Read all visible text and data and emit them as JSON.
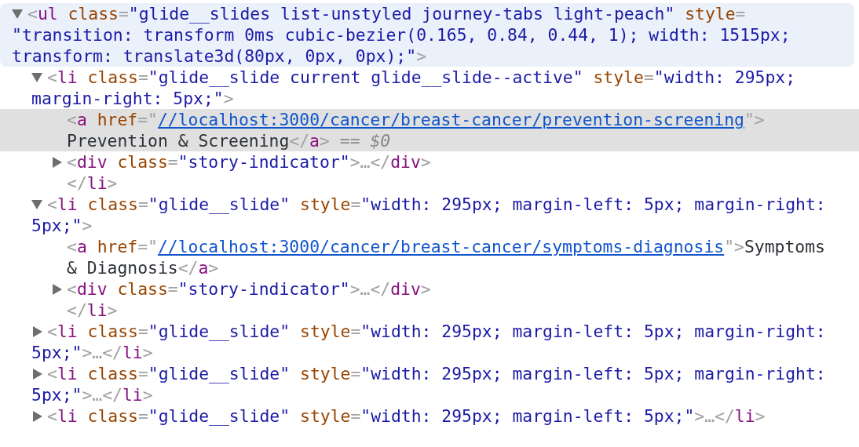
{
  "elements": [
    {
      "hovered": true,
      "expanded": true,
      "lines": [
        [
          {
            "kind": "punct",
            "text": "<"
          },
          {
            "kind": "tag",
            "text": "ul"
          },
          {
            "kind": "attr",
            "text": " class"
          },
          {
            "kind": "punct",
            "text": "="
          },
          {
            "kind": "value",
            "text": "\"glide__slides list-unstyled journey-tabs light-peach\""
          },
          {
            "kind": "attr",
            "text": " style"
          },
          {
            "kind": "punct",
            "text": "="
          }
        ],
        [
          {
            "kind": "value",
            "text": "\"transition: transform 0ms cubic-bezier(0.165, 0.84, 0.44, 1); width: 1515px;"
          }
        ],
        [
          {
            "kind": "value",
            "text": "transform: translate3d(80px, 0px, 0px);\""
          },
          {
            "kind": "punct",
            "text": ">"
          }
        ]
      ],
      "children": [
        {
          "expanded": true,
          "lines": [
            [
              {
                "kind": "punct",
                "text": "<"
              },
              {
                "kind": "tag",
                "text": "li"
              },
              {
                "kind": "attr",
                "text": " class"
              },
              {
                "kind": "punct",
                "text": "="
              },
              {
                "kind": "value",
                "text": "\"glide__slide current glide__slide--active\""
              },
              {
                "kind": "attr",
                "text": " style"
              },
              {
                "kind": "punct",
                "text": "="
              },
              {
                "kind": "value",
                "text": "\"width: 295px;"
              }
            ],
            [
              {
                "kind": "value",
                "text": "margin-right: 5px;\""
              },
              {
                "kind": "punct",
                "text": ">"
              }
            ]
          ],
          "children": [
            {
              "selected": true,
              "lines": [
                [
                  {
                    "kind": "punct",
                    "text": "<"
                  },
                  {
                    "kind": "tag",
                    "text": "a"
                  },
                  {
                    "kind": "attr",
                    "text": " href"
                  },
                  {
                    "kind": "punct",
                    "text": "=\""
                  },
                  {
                    "kind": "link",
                    "text": "//localhost:3000/cancer/breast-cancer/prevention-screening"
                  },
                  {
                    "kind": "punct",
                    "text": "\">"
                  }
                ],
                [
                  {
                    "kind": "text",
                    "text": "Prevention & Screening"
                  },
                  {
                    "kind": "punct",
                    "text": "</"
                  },
                  {
                    "kind": "tag",
                    "text": "a"
                  },
                  {
                    "kind": "punct",
                    "text": ">"
                  },
                  {
                    "kind": "dim",
                    "text": " == "
                  },
                  {
                    "kind": "var",
                    "text": "$0"
                  }
                ]
              ]
            },
            {
              "expanded": false,
              "lines": [
                [
                  {
                    "kind": "punct",
                    "text": "<"
                  },
                  {
                    "kind": "tag",
                    "text": "div"
                  },
                  {
                    "kind": "attr",
                    "text": " class"
                  },
                  {
                    "kind": "punct",
                    "text": "="
                  },
                  {
                    "kind": "value",
                    "text": "\"story-indicator\""
                  },
                  {
                    "kind": "punct",
                    "text": ">…</"
                  },
                  {
                    "kind": "tag",
                    "text": "div"
                  },
                  {
                    "kind": "punct",
                    "text": ">"
                  }
                ]
              ]
            },
            {
              "lines": [
                [
                  {
                    "kind": "punct",
                    "text": "</"
                  },
                  {
                    "kind": "tag",
                    "text": "li"
                  },
                  {
                    "kind": "punct",
                    "text": ">"
                  }
                ]
              ]
            }
          ]
        },
        {
          "expanded": true,
          "lines": [
            [
              {
                "kind": "punct",
                "text": "<"
              },
              {
                "kind": "tag",
                "text": "li"
              },
              {
                "kind": "attr",
                "text": " class"
              },
              {
                "kind": "punct",
                "text": "="
              },
              {
                "kind": "value",
                "text": "\"glide__slide\""
              },
              {
                "kind": "attr",
                "text": " style"
              },
              {
                "kind": "punct",
                "text": "="
              },
              {
                "kind": "value",
                "text": "\"width: 295px; margin-left: 5px; margin-right:"
              }
            ],
            [
              {
                "kind": "value",
                "text": "5px;\""
              },
              {
                "kind": "punct",
                "text": ">"
              }
            ]
          ],
          "children": [
            {
              "selected": false,
              "lines": [
                [
                  {
                    "kind": "punct",
                    "text": "<"
                  },
                  {
                    "kind": "tag",
                    "text": "a"
                  },
                  {
                    "kind": "attr",
                    "text": " href"
                  },
                  {
                    "kind": "punct",
                    "text": "=\""
                  },
                  {
                    "kind": "link",
                    "text": "//localhost:3000/cancer/breast-cancer/symptoms-diagnosis"
                  },
                  {
                    "kind": "punct",
                    "text": "\">"
                  },
                  {
                    "kind": "text",
                    "text": "Symptoms"
                  }
                ],
                [
                  {
                    "kind": "text",
                    "text": "& Diagnosis"
                  },
                  {
                    "kind": "punct",
                    "text": "</"
                  },
                  {
                    "kind": "tag",
                    "text": "a"
                  },
                  {
                    "kind": "punct",
                    "text": ">"
                  }
                ]
              ]
            },
            {
              "expanded": false,
              "lines": [
                [
                  {
                    "kind": "punct",
                    "text": "<"
                  },
                  {
                    "kind": "tag",
                    "text": "div"
                  },
                  {
                    "kind": "attr",
                    "text": " class"
                  },
                  {
                    "kind": "punct",
                    "text": "="
                  },
                  {
                    "kind": "value",
                    "text": "\"story-indicator\""
                  },
                  {
                    "kind": "punct",
                    "text": ">…</"
                  },
                  {
                    "kind": "tag",
                    "text": "div"
                  },
                  {
                    "kind": "punct",
                    "text": ">"
                  }
                ]
              ]
            },
            {
              "lines": [
                [
                  {
                    "kind": "punct",
                    "text": "</"
                  },
                  {
                    "kind": "tag",
                    "text": "li"
                  },
                  {
                    "kind": "punct",
                    "text": ">"
                  }
                ]
              ]
            }
          ]
        },
        {
          "expanded": false,
          "lines": [
            [
              {
                "kind": "punct",
                "text": "<"
              },
              {
                "kind": "tag",
                "text": "li"
              },
              {
                "kind": "attr",
                "text": " class"
              },
              {
                "kind": "punct",
                "text": "="
              },
              {
                "kind": "value",
                "text": "\"glide__slide\""
              },
              {
                "kind": "attr",
                "text": " style"
              },
              {
                "kind": "punct",
                "text": "="
              },
              {
                "kind": "value",
                "text": "\"width: 295px; margin-left: 5px; margin-right:"
              }
            ],
            [
              {
                "kind": "value",
                "text": "5px;\""
              },
              {
                "kind": "punct",
                "text": ">…</"
              },
              {
                "kind": "tag",
                "text": "li"
              },
              {
                "kind": "punct",
                "text": ">"
              }
            ]
          ]
        },
        {
          "expanded": false,
          "lines": [
            [
              {
                "kind": "punct",
                "text": "<"
              },
              {
                "kind": "tag",
                "text": "li"
              },
              {
                "kind": "attr",
                "text": " class"
              },
              {
                "kind": "punct",
                "text": "="
              },
              {
                "kind": "value",
                "text": "\"glide__slide\""
              },
              {
                "kind": "attr",
                "text": " style"
              },
              {
                "kind": "punct",
                "text": "="
              },
              {
                "kind": "value",
                "text": "\"width: 295px; margin-left: 5px; margin-right:"
              }
            ],
            [
              {
                "kind": "value",
                "text": "5px;\""
              },
              {
                "kind": "punct",
                "text": ">…</"
              },
              {
                "kind": "tag",
                "text": "li"
              },
              {
                "kind": "punct",
                "text": ">"
              }
            ]
          ]
        },
        {
          "expanded": false,
          "lines": [
            [
              {
                "kind": "punct",
                "text": "<"
              },
              {
                "kind": "tag",
                "text": "li"
              },
              {
                "kind": "attr",
                "text": " class"
              },
              {
                "kind": "punct",
                "text": "="
              },
              {
                "kind": "value",
                "text": "\"glide__slide\""
              },
              {
                "kind": "attr",
                "text": " style"
              },
              {
                "kind": "punct",
                "text": "="
              },
              {
                "kind": "value",
                "text": "\"width: 295px; margin-left: 5px;\""
              },
              {
                "kind": "punct",
                "text": ">…</"
              },
              {
                "kind": "tag",
                "text": "li"
              },
              {
                "kind": "punct",
                "text": ">"
              }
            ]
          ]
        }
      ]
    }
  ]
}
